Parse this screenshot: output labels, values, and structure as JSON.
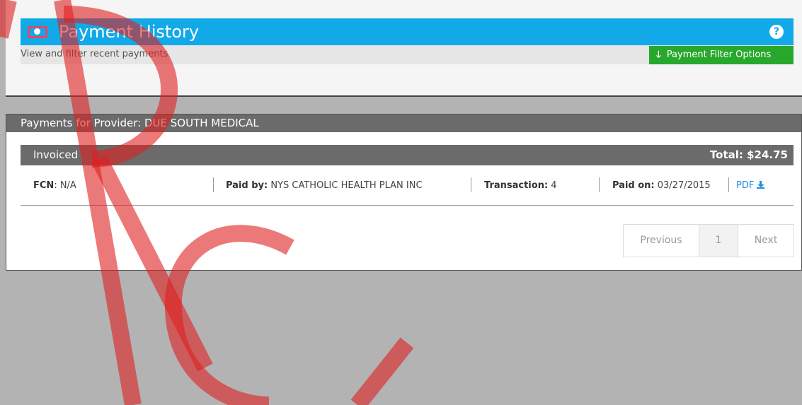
{
  "header": {
    "title": "Payment History",
    "subtitle": "View and filter recent payments",
    "filter_button_label": "Payment Filter Options",
    "help_symbol": "?",
    "icons": {
      "title": "money-icon",
      "help": "question-circle-icon",
      "filter": "arrow-down-icon"
    }
  },
  "provider": {
    "prefix": "Payments for Provider:",
    "name": "DUE SOUTH MEDICAL"
  },
  "section": {
    "label": "Invoiced",
    "total": "Total: $24.75"
  },
  "payment": {
    "fcn_label": "FCN",
    "fcn_value": ": N/A",
    "paid_by_label": "Paid by:",
    "paid_by_value": " NYS CATHOLIC HEALTH PLAN INC",
    "transaction_label": "Transaction:",
    "transaction_value": " 4",
    "paid_on_label": "Paid on:",
    "paid_on_value": " 03/27/2015",
    "pdf_label": "PDF"
  },
  "pagination": {
    "previous": "Previous",
    "current_page": "1",
    "next": "Next"
  },
  "colors": {
    "header_blue": "#12a9e8",
    "filter_green": "#27a82c",
    "bar_gray": "#6b6b6b",
    "link_blue": "#1a8fd8",
    "watermark_red": "#e02020"
  }
}
